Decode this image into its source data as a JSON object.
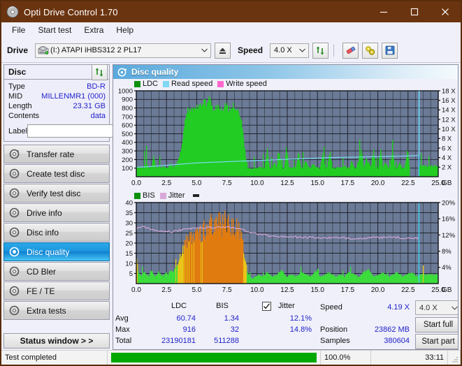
{
  "window": {
    "title": "Opti Drive Control 1.70",
    "titlebar_color": "#6b3410",
    "minimize": "─",
    "maximize": "☐",
    "close": "✕"
  },
  "menubar": {
    "items": [
      "File",
      "Start test",
      "Extra",
      "Help"
    ]
  },
  "toolbar": {
    "drive_label": "Drive",
    "drive_value": "(I:)   ATAPI iHBS312  2 PL17",
    "eject_icon": "eject-icon",
    "speed_label": "Speed",
    "speed_value": "4.0 X",
    "refresh_icon": "refresh-icon",
    "erase_icon": "eraser-icon",
    "tools_icon": "tools-icon",
    "save_icon": "save-icon"
  },
  "sidebar": {
    "disc_panel": {
      "title": "Disc",
      "refresh_icon": "refresh-icon",
      "rows": [
        {
          "key": "Type",
          "value": "BD-R"
        },
        {
          "key": "MID",
          "value": "MILLENMR1 (000)"
        },
        {
          "key": "Length",
          "value": "23.31 GB"
        },
        {
          "key": "Contents",
          "value": "data"
        }
      ],
      "label_key": "Label",
      "label_value": "",
      "label_placeholder": "",
      "disc_icon": "disc-icon"
    },
    "nav": [
      {
        "label": "Transfer rate",
        "icon": "disc-icon",
        "active": false
      },
      {
        "label": "Create test disc",
        "icon": "disc-icon",
        "active": false
      },
      {
        "label": "Verify test disc",
        "icon": "disc-icon",
        "active": false
      },
      {
        "label": "Drive info",
        "icon": "disc-icon",
        "active": false
      },
      {
        "label": "Disc info",
        "icon": "disc-icon",
        "active": false
      },
      {
        "label": "Disc quality",
        "icon": "disc-icon",
        "active": true
      },
      {
        "label": "CD Bler",
        "icon": "disc-icon",
        "active": false
      },
      {
        "label": "FE / TE",
        "icon": "disc-icon",
        "active": false
      },
      {
        "label": "Extra tests",
        "icon": "disc-icon",
        "active": false
      }
    ],
    "status_window_button": "Status window > >"
  },
  "main": {
    "header_title": "Disc quality",
    "header_icon": "disc-icon"
  },
  "stats": {
    "col_headers": [
      "LDC",
      "BIS"
    ],
    "row_labels": [
      "Avg",
      "Max",
      "Total"
    ],
    "ldc": {
      "avg": "60.74",
      "max": "916",
      "total": "23190181"
    },
    "bis": {
      "avg": "1.34",
      "max": "32",
      "total": "511288"
    },
    "jitter": {
      "label": "Jitter",
      "checked": true,
      "avg": "12.1%",
      "max": "14.8%"
    },
    "speed_label": "Speed",
    "speed_value": "4.19 X",
    "position_label": "Position",
    "position_value": "23862 MB",
    "samples_label": "Samples",
    "samples_value": "380604",
    "speed_select": "4.0 X",
    "start_full_button": "Start full",
    "start_part_button": "Start part"
  },
  "statusbar": {
    "text": "Test completed",
    "progress_percent": 100.0,
    "percent_text": "100.0%",
    "elapsed": "33:11",
    "progress_color": "#00a800"
  },
  "colors": {
    "plot_bg": "#6b7a96",
    "plot_grid": "#2b2f3a",
    "ldc_green": "#22cc22",
    "bis_green": "#3ddc3d",
    "read_speed": "#7fd8f5",
    "write_speed": "#ff66cc",
    "jitter_pink": "#d9a8d9",
    "cursor_cyan": "#3fd2f2",
    "value_blue": "#2222cc"
  },
  "chart_data": [
    {
      "id": "disc-quality-ldc-chart",
      "type": "area",
      "title": "Disc quality",
      "xlabel": "GB",
      "ylabel": "LDC",
      "xlim": [
        0,
        25
      ],
      "ylim": [
        0,
        1000
      ],
      "y2lim": [
        0,
        18
      ],
      "y2label": "X",
      "grid": true,
      "xticks": [
        "0.0",
        "2.5",
        "5.0",
        "7.5",
        "10.0",
        "12.5",
        "15.0",
        "17.5",
        "20.0",
        "22.5",
        "25.0"
      ],
      "yticks": [
        "100",
        "200",
        "300",
        "400",
        "500",
        "600",
        "700",
        "800",
        "900",
        "1000"
      ],
      "y2ticks": [
        "2 X",
        "4 X",
        "6 X",
        "8 X",
        "10 X",
        "12 X",
        "14 X",
        "16 X",
        "18 X"
      ],
      "legend": [
        {
          "name": "LDC",
          "color": "#0f8f0f"
        },
        {
          "name": "Read speed",
          "color": "#7fd8f5"
        },
        {
          "name": "Write speed",
          "color": "#ff66cc"
        }
      ],
      "legend_position": "top-left",
      "series": [
        {
          "name": "LDC",
          "color": "#22cc22",
          "x": [
            0.0,
            0.2,
            0.4,
            0.6,
            0.8,
            1.0,
            1.2,
            1.4,
            1.6,
            1.8,
            2.0,
            2.2,
            2.4,
            2.6,
            2.8,
            3.0,
            3.2,
            3.4,
            3.6,
            3.8,
            4.0,
            4.2,
            4.4,
            4.6,
            4.8,
            5.0,
            5.2,
            5.4,
            5.6,
            5.8,
            6.0,
            6.2,
            6.4,
            6.6,
            6.8,
            7.0,
            7.2,
            7.4,
            7.6,
            7.8,
            8.0,
            8.2,
            8.4,
            8.6,
            8.8,
            9.0,
            9.2,
            9.4,
            9.6,
            9.8,
            10.0,
            10.2,
            10.4,
            10.6,
            10.8,
            11.0,
            11.2,
            11.4,
            11.6,
            11.8,
            12.0,
            12.2,
            12.4,
            12.6,
            12.8,
            13.0,
            13.2,
            13.4,
            13.6,
            13.8,
            14.0,
            14.2,
            14.4,
            14.6,
            14.8,
            15.0,
            15.2,
            15.4,
            15.6,
            15.8,
            16.0,
            16.2,
            16.4,
            16.6,
            16.8,
            17.0,
            17.2,
            17.4,
            17.6,
            17.8,
            18.0,
            18.2,
            18.4,
            18.6,
            18.8,
            19.0,
            19.2,
            19.4,
            19.6,
            19.8,
            20.0,
            20.2,
            20.4,
            20.6,
            20.8,
            21.0,
            21.2,
            21.4,
            21.6,
            21.8,
            22.0,
            22.2,
            22.4,
            22.6,
            22.8,
            23.0,
            23.2,
            23.4
          ],
          "values": [
            110,
            95,
            90,
            100,
            150,
            95,
            90,
            210,
            95,
            100,
            95,
            110,
            90,
            95,
            130,
            95,
            110,
            170,
            230,
            420,
            640,
            760,
            790,
            780,
            800,
            790,
            800,
            830,
            880,
            790,
            920,
            800,
            780,
            790,
            800,
            770,
            790,
            830,
            760,
            790,
            820,
            790,
            760,
            700,
            520,
            220,
            90,
            85,
            80,
            90,
            95,
            100,
            90,
            95,
            290,
            95,
            90,
            150,
            90,
            270,
            95,
            90,
            305,
            95,
            90,
            110,
            95,
            250,
            90,
            95,
            180,
            95,
            90,
            140,
            95,
            90,
            95,
            230,
            95,
            90,
            270,
            95,
            90,
            95,
            90,
            95,
            110,
            90,
            95,
            170,
            90,
            95,
            190,
            300,
            95,
            180,
            150,
            95,
            290,
            95,
            90,
            310,
            95,
            150,
            90,
            95,
            280,
            90,
            95,
            150,
            90,
            95,
            270,
            110
          ]
        },
        {
          "name": "Read speed",
          "color": "#7fd8f5",
          "x": [
            0.0,
            1.0,
            2.0,
            3.0,
            4.0,
            5.0,
            6.0,
            7.0,
            8.0,
            9.0,
            10.0,
            11.0,
            12.0,
            13.0,
            14.0,
            15.0,
            16.0,
            17.0,
            18.0,
            19.0,
            20.0,
            21.0,
            22.0,
            23.0,
            23.4,
            23.4
          ],
          "values_x": [
            2.0,
            2.1,
            2.3,
            2.5,
            2.7,
            2.9,
            3.0,
            3.1,
            3.2,
            3.3,
            3.4,
            3.5,
            3.6,
            3.7,
            3.8,
            3.9,
            4.0,
            4.05,
            4.1,
            4.15,
            4.2,
            4.25,
            4.3,
            4.4,
            4.45,
            18.0
          ]
        },
        {
          "name": "Write speed",
          "color": "#ff66cc",
          "x": [],
          "values": []
        }
      ],
      "cursor_x": 23.4
    },
    {
      "id": "disc-quality-bis-chart",
      "type": "area",
      "xlabel": "GB",
      "ylabel": "BIS",
      "xlim": [
        0,
        25
      ],
      "ylim": [
        0,
        40
      ],
      "y2lim": [
        0,
        20
      ],
      "y2label": "%",
      "grid": true,
      "xticks": [
        "0.0",
        "2.5",
        "5.0",
        "7.5",
        "10.0",
        "12.5",
        "15.0",
        "17.5",
        "20.0",
        "22.5",
        "25.0"
      ],
      "yticks": [
        "5",
        "10",
        "15",
        "20",
        "25",
        "30",
        "35",
        "40"
      ],
      "y2ticks": [
        "4%",
        "8%",
        "12%",
        "16%",
        "20%"
      ],
      "legend": [
        {
          "name": "BIS",
          "color": "#0f8f0f"
        },
        {
          "name": "Jitter",
          "color": "#d9a8d9"
        }
      ],
      "legend_position": "top-left",
      "series": [
        {
          "name": "BIS",
          "color": "#3ddc3d",
          "x": [
            0.0,
            0.2,
            0.4,
            0.6,
            0.8,
            1.0,
            1.2,
            1.4,
            1.6,
            1.8,
            2.0,
            2.2,
            2.4,
            2.6,
            2.8,
            3.0,
            3.2,
            3.4,
            3.6,
            3.8,
            4.0,
            4.2,
            4.4,
            4.6,
            4.8,
            5.0,
            5.2,
            5.4,
            5.6,
            5.8,
            6.0,
            6.2,
            6.4,
            6.6,
            6.8,
            7.0,
            7.2,
            7.4,
            7.6,
            7.8,
            8.0,
            8.2,
            8.4,
            8.6,
            8.8,
            9.0,
            9.2,
            9.4,
            9.6,
            9.8,
            10.0,
            10.4,
            10.8,
            11.2,
            11.6,
            12.0,
            12.4,
            12.8,
            13.2,
            13.6,
            14.0,
            14.4,
            14.8,
            15.2,
            15.6,
            16.0,
            16.4,
            16.8,
            17.2,
            17.6,
            18.0,
            18.4,
            18.8,
            19.2,
            19.6,
            20.0,
            20.4,
            20.8,
            21.2,
            21.6,
            22.0,
            22.4,
            22.8,
            23.2,
            23.4
          ],
          "values": [
            10,
            4,
            3,
            5,
            4,
            3,
            6,
            4,
            3,
            5,
            4,
            3,
            5,
            4,
            6,
            5,
            7,
            9,
            12,
            16,
            19,
            21,
            22,
            23,
            23,
            24,
            23,
            24,
            25,
            24,
            26,
            28,
            25,
            27,
            29,
            26,
            28,
            30,
            27,
            26,
            28,
            25,
            26,
            22,
            17,
            10,
            4,
            3,
            2,
            3,
            4,
            3,
            5,
            3,
            4,
            6,
            3,
            4,
            3,
            5,
            4,
            3,
            6,
            3,
            4,
            5,
            3,
            4,
            3,
            5,
            4,
            3,
            5,
            6,
            3,
            4,
            5,
            3,
            4,
            5,
            3,
            4,
            5,
            3,
            4
          ]
        },
        {
          "name": "Jitter",
          "color": "#d9a8d9",
          "x": [
            0.0,
            0.5,
            1.0,
            1.5,
            2.0,
            2.5,
            3.0,
            3.5,
            4.0,
            4.5,
            5.0,
            5.5,
            6.0,
            6.5,
            7.0,
            7.5,
            8.0,
            8.5,
            9.0,
            9.5,
            10.0,
            10.5,
            11.0,
            11.5,
            12.0,
            12.5,
            13.0,
            13.5,
            14.0,
            14.5,
            15.0,
            15.5,
            16.0,
            16.5,
            17.0,
            17.5,
            18.0,
            18.5,
            19.0,
            19.5,
            20.0,
            20.5,
            21.0,
            21.5,
            22.0,
            22.5,
            23.0,
            23.4
          ],
          "values_pct": [
            13.5,
            14.3,
            13.6,
            13.0,
            12.8,
            12.9,
            12.8,
            13.1,
            13.3,
            13.6,
            13.8,
            13.7,
            13.8,
            13.9,
            13.9,
            14.0,
            13.9,
            13.6,
            13.1,
            12.5,
            12.3,
            12.1,
            11.8,
            11.7,
            11.6,
            11.6,
            11.5,
            11.5,
            11.4,
            11.4,
            11.3,
            11.3,
            11.3,
            11.3,
            11.2,
            11.2,
            11.2,
            11.2,
            11.2,
            11.3,
            11.3,
            11.4,
            11.3,
            11.4,
            11.3,
            11.2,
            11.2,
            11.2
          ]
        }
      ],
      "cursor_x": 23.4
    }
  ]
}
